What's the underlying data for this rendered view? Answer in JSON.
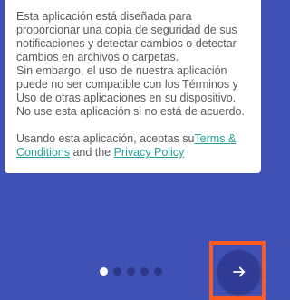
{
  "card": {
    "paragraph1": "Esta aplicación está diseñada para proporcionar una copia de seguridad de sus notificaciones y detectar cambios o detectar cambios en archivos o carpetas.",
    "paragraph2": "Sin embargo, el uso de nuestra aplicación puede no ser compatible con los Términos y Uso de otras aplicaciones en su dispositivo. No use esta aplicación si no está de acuerdo.",
    "paragraph3_prefix": "Usando esta aplicación, aceptas su",
    "terms_link": "Terms & Conditions",
    "paragraph3_middle": " and the ",
    "privacy_link": "Privacy Policy"
  },
  "pager": {
    "total_pages": 5,
    "current_page": 1
  },
  "next_button": {
    "icon": "arrow-right-icon",
    "highlighted": true
  },
  "colors": {
    "background": "#3f51b5",
    "link": "#2aa198",
    "highlight": "#ff5a1f"
  }
}
